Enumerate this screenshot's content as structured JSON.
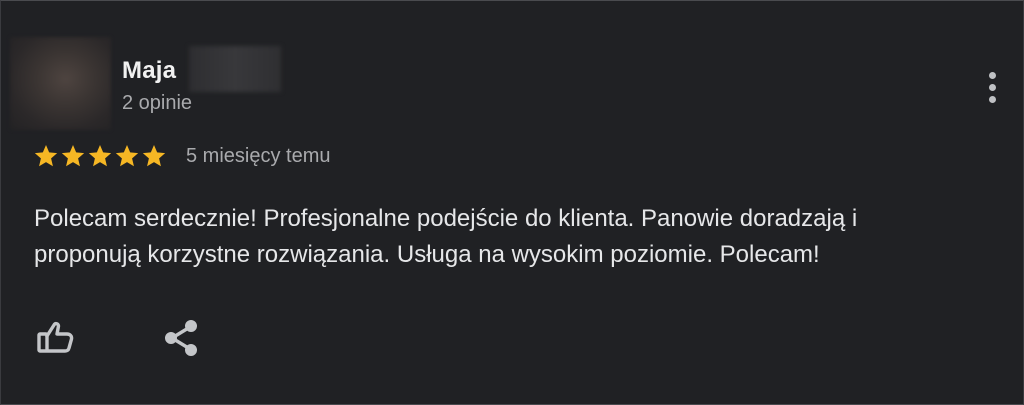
{
  "review": {
    "author_name": "Maja",
    "author_reviews": "2 opinie",
    "rating": 5,
    "rating_max": 5,
    "date": "5 miesięcy temu",
    "text": "Polecam serdecznie! Profesjonalne podejście do klienta. Panowie doradzają i\nproponują korzystne rozwiązania. Usługa na wysokim poziomie. Polecam!"
  },
  "icons": {
    "more": "more-vertical-icon",
    "like": "thumbs-up-icon",
    "share": "share-icon",
    "star": "star-icon"
  },
  "colors": {
    "background": "#202124",
    "star": "#f6b724",
    "text_primary": "#e6e7e9",
    "text_secondary": "#a9aaad",
    "icon": "#c4c6c9"
  }
}
